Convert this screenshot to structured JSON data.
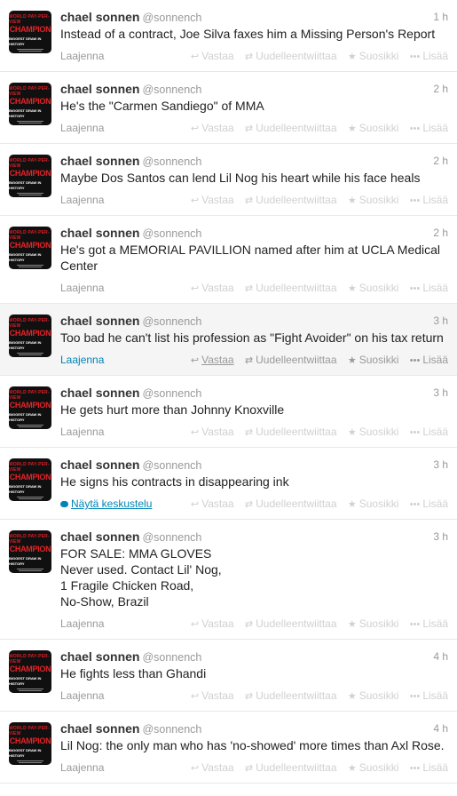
{
  "avatar_text": {
    "line1": "WORLD PAY-PER-VIEW",
    "line2": "CHAMPION",
    "line3": "BIGGEST DRAW IN HISTORY"
  },
  "actions": {
    "reply": "Vastaa",
    "retweet": "Uudelleentwiittaa",
    "favorite": "Suosikki",
    "more": "Lisää",
    "reply_icon": "reply-arrow-icon",
    "retweet_icon": "retweet-icon",
    "favorite_icon": "star-icon",
    "more_icon": "more-dots-icon"
  },
  "colors": {
    "link": "#0084b4",
    "muted": "#999999",
    "hover_bg": "#f5f5f5",
    "avatar_red": "#e32228"
  },
  "tweets": [
    {
      "name": "chael sonnen",
      "handle": "@sonnench",
      "time": "1 h",
      "text": "Instead of a contract, Joe Silva faxes him a Missing Person's Report",
      "footer": "Laajenna"
    },
    {
      "name": "chael sonnen",
      "handle": "@sonnench",
      "time": "2 h",
      "text": "He's the \"Carmen Sandiego\" of MMA",
      "footer": "Laajenna"
    },
    {
      "name": "chael sonnen",
      "handle": "@sonnench",
      "time": "2 h",
      "text": "Maybe Dos Santos can lend Lil Nog his heart while his face heals",
      "footer": "Laajenna"
    },
    {
      "name": "chael sonnen",
      "handle": "@sonnench",
      "time": "2 h",
      "text": "He's got a MEMORIAL PAVILLION named after him at UCLA Medical Center",
      "footer": "Laajenna"
    },
    {
      "name": "chael sonnen",
      "handle": "@sonnench",
      "time": "3 h",
      "text": "Too bad he can't list his profession as \"Fight Avoider\" on his tax return",
      "footer": "Laajenna",
      "hovered": true
    },
    {
      "name": "chael sonnen",
      "handle": "@sonnench",
      "time": "3 h",
      "text": "He gets hurt more than Johnny Knoxville",
      "footer": "Laajenna"
    },
    {
      "name": "chael sonnen",
      "handle": "@sonnench",
      "time": "3 h",
      "text": "He signs his contracts in disappearing ink",
      "footer": "Näytä keskustelu",
      "conversation": true
    },
    {
      "name": "chael sonnen",
      "handle": "@sonnench",
      "time": "3 h",
      "text": "FOR SALE: MMA GLOVES\nNever used. Contact Lil' Nog,\n1 Fragile Chicken Road,\nNo-Show, Brazil",
      "footer": "Laajenna"
    },
    {
      "name": "chael sonnen",
      "handle": "@sonnench",
      "time": "4 h",
      "text": "He fights less than Ghandi",
      "footer": "Laajenna"
    },
    {
      "name": "chael sonnen",
      "handle": "@sonnench",
      "time": "4 h",
      "text": "Lil Nog: the only man who has 'no-showed' more times than Axl Rose.",
      "footer": "Laajenna"
    }
  ]
}
